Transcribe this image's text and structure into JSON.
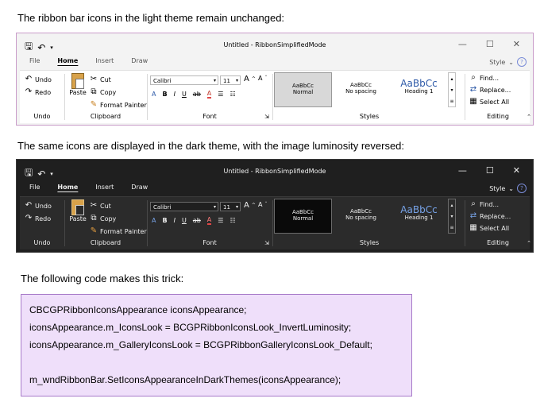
{
  "captions": {
    "light": "The ribbon bar icons in the light theme remain unchanged:",
    "dark": "The same icons are displayed in the dark theme, with the image luminosity reversed:",
    "code": "The following code makes this trick:"
  },
  "window": {
    "title": "Untitled - RibbonSimplifiedMode",
    "tabs": [
      "File",
      "Home",
      "Insert",
      "Draw"
    ],
    "style_tab": "Style",
    "minimize": "—",
    "maximize": "☐",
    "close": "✕"
  },
  "ribbon": {
    "undo_group": {
      "undo": "Undo",
      "redo": "Redo",
      "name": "Undo"
    },
    "clipboard_group": {
      "paste": "Paste",
      "cut": "Cut",
      "copy": "Copy",
      "format_painter": "Format Painter",
      "name": "Clipboard"
    },
    "font_group": {
      "font_name": "Calibri",
      "font_size": "11",
      "grow": "A",
      "shrink": "A",
      "bold": "B",
      "italic": "I",
      "underline": "U",
      "strike": "ab",
      "highlight": "A",
      "name": "Font"
    },
    "styles_group": {
      "items": [
        {
          "preview": "AaBbCc",
          "label": "Normal"
        },
        {
          "preview": "AaBbCc",
          "label": "No spacing"
        },
        {
          "preview": "AaBbCc",
          "label": "Heading 1"
        }
      ],
      "name": "Styles"
    },
    "editing_group": {
      "find": "Find...",
      "replace": "Replace...",
      "select_all": "Select All",
      "name": "Editing"
    }
  },
  "code_lines": [
    "CBCGPRibbonIconsAppearance iconsAppearance;",
    "iconsAppearance.m_IconsLook = BCGPRibbonIconsLook_InvertLuminosity;",
    "iconsAppearance.m_GalleryIconsLook = BCGPRibbonGalleryIconsLook_Default;",
    "",
    "m_wndRibbonBar.SetIconsAppearanceInDarkThemes(iconsAppearance);"
  ]
}
